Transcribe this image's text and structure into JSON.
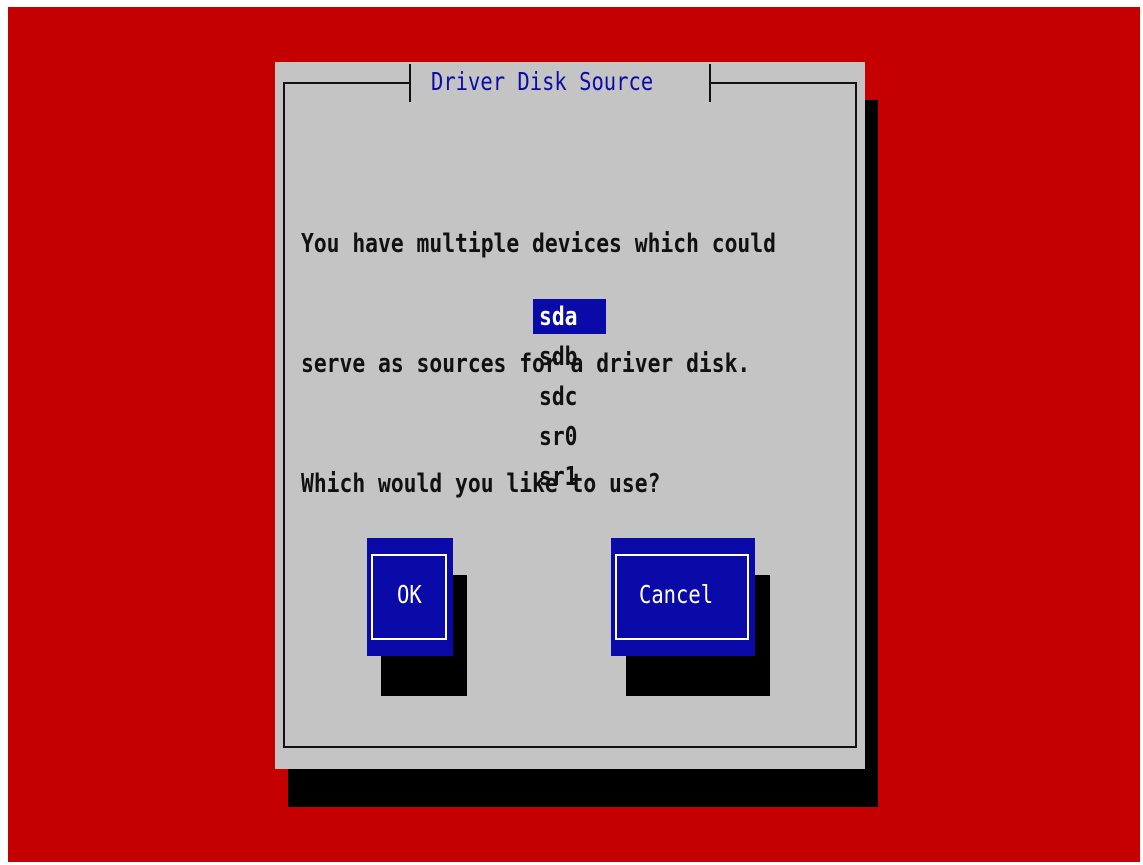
{
  "dialog": {
    "title": "Driver Disk Source",
    "message": [
      "You have multiple devices which could",
      "serve as sources for a driver disk.",
      "Which would you like to use?"
    ],
    "devices": [
      "sda",
      "sdb",
      "sdc",
      "sr0",
      "sr1"
    ],
    "selected_device": "sda",
    "ok_label": "OK",
    "cancel_label": "Cancel"
  },
  "colors": {
    "background": "#c40000",
    "dialog": "#c4c4c4",
    "accent": "#0a0aa8",
    "shadow": "#000000"
  }
}
